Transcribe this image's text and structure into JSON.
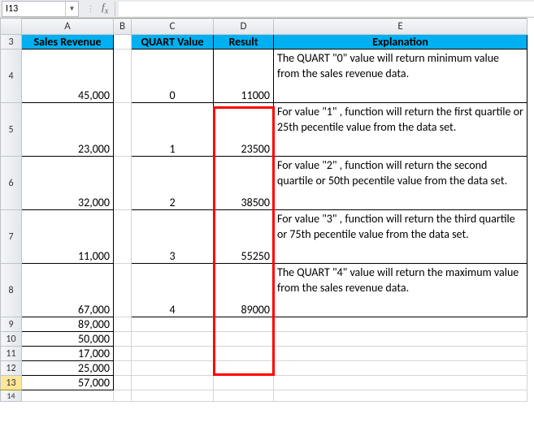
{
  "nameBox": {
    "cellRef": "I13"
  },
  "columns": {
    "A": "A",
    "B": "B",
    "C": "C",
    "D": "D",
    "E": "E"
  },
  "rowNums": [
    "3",
    "4",
    "5",
    "6",
    "7",
    "8",
    "9",
    "10",
    "11",
    "12",
    "13",
    "14"
  ],
  "headers": {
    "sales": "Sales Revenue",
    "quart": "QUART Value",
    "result": "Result",
    "explanation": "Explanation"
  },
  "rows": [
    {
      "sales": "45,000",
      "quart": "0",
      "result": "11000",
      "explain": "The QUART \"0\" value will return minimum value from the sales revenue data."
    },
    {
      "sales": "23,000",
      "quart": "1",
      "result": "23500",
      "explain": "For value \"1\" , function will return the first quartile or 25th pecentile value from the data set."
    },
    {
      "sales": "32,000",
      "quart": "2",
      "result": "38500",
      "explain": "For value \"2\" , function will return the second quartile or 50th pecentile value from the data set."
    },
    {
      "sales": "11,000",
      "quart": "3",
      "result": "55250",
      "explain": "For value \"3\" , function will return the third quartile or 75th pecentile value from the data set."
    },
    {
      "sales": "67,000",
      "quart": "4",
      "result": "89000",
      "explain": "The QUART \"4\" value will return the maximum value from the sales revenue data."
    }
  ],
  "extraSales": [
    "89,000",
    "50,000",
    "17,000",
    "25,000",
    "57,000"
  ]
}
